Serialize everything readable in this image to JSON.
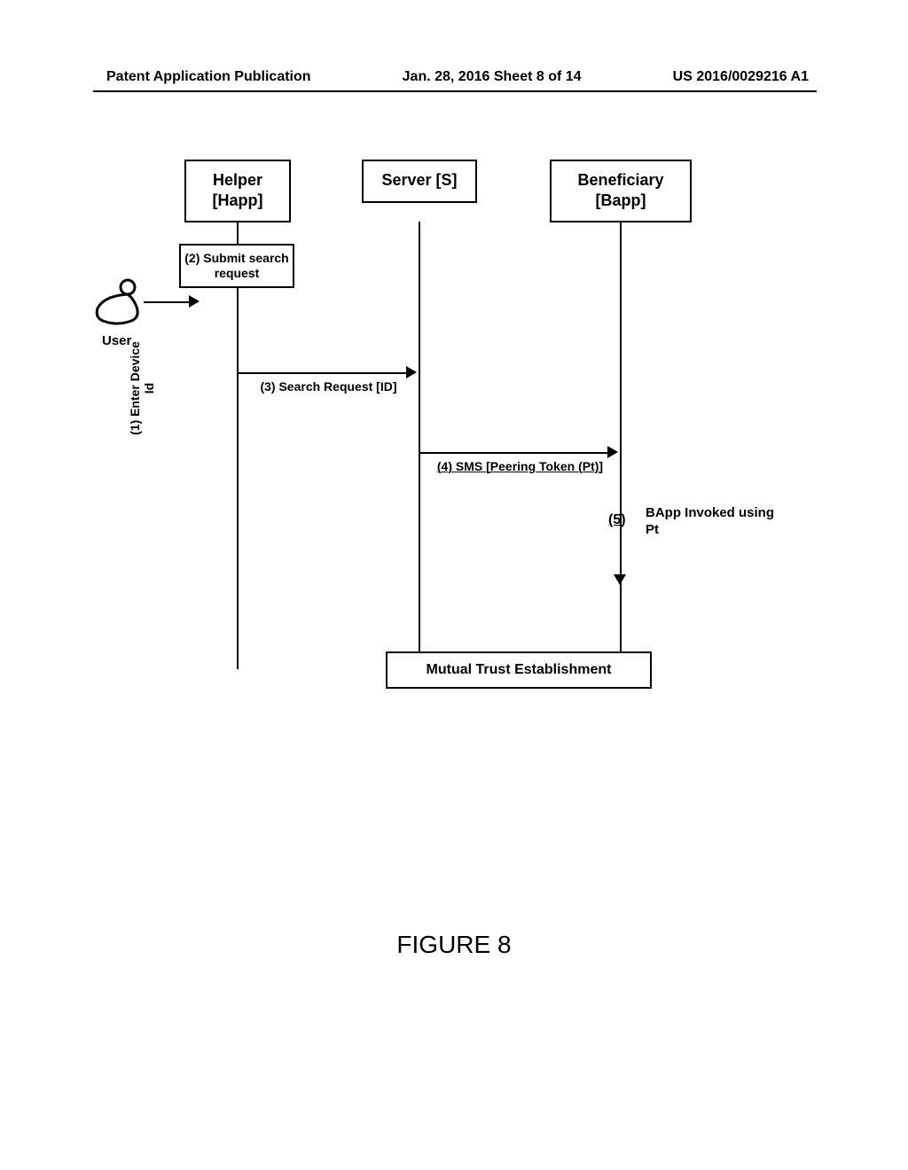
{
  "header": {
    "left": "Patent Application Publication",
    "center": "Jan. 28, 2016  Sheet 8 of 14",
    "right": "US 2016/0029216 A1"
  },
  "actors": {
    "helper": "Helper\n[Happ]",
    "server": "Server [S]",
    "beneficiary": "Beneficiary\n[Bapp]"
  },
  "user": {
    "label": "User"
  },
  "steps": {
    "s1": "(1) Enter Device Id",
    "s2": "(2) Submit search request",
    "s3": "(3)   Search Request [ID]",
    "s4": "(4) SMS [Peering Token (Pt)]",
    "s5_num": "(5)",
    "s5_text": "BApp Invoked using Pt"
  },
  "trust": "Mutual Trust Establishment",
  "figure_caption": "FIGURE 8"
}
